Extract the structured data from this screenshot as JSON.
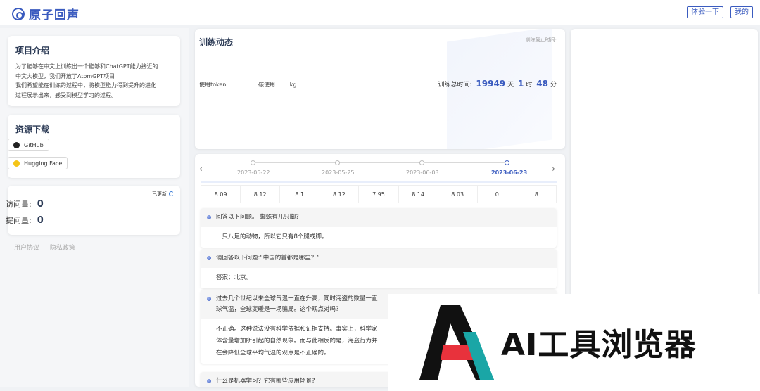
{
  "header": {
    "logo_text": "原子回声",
    "try_button": "体验一下",
    "mine_button": "我的"
  },
  "intro": {
    "title": "项目介绍",
    "lines": [
      "为了能够在中文上训练出一个能够和ChatGPT能力接近的",
      "中文大模型，我们开放了AtomGPT项目",
      "我们希望能在训练的过程中，将模型能力得到提升的进化",
      "过程展示出来，感受到模型学习的过程。"
    ]
  },
  "downloads": {
    "title": "资源下载",
    "github": "GitHub",
    "huggingface": "Hugging Face"
  },
  "stats": {
    "updated": "已更新",
    "visit_label": "访问量:",
    "visit_value": "0",
    "ask_label": "提问量:",
    "ask_value": "0"
  },
  "footer": {
    "agreement": "用户协议",
    "privacy": "隐私政策"
  },
  "training": {
    "title": "训练动态",
    "deadline": "训练截止时间:",
    "token_label": "使用token:",
    "carbon_label": "碳使用:",
    "carbon_unit": "kg",
    "total_label": "训练总时间:",
    "days": "19949",
    "days_unit": "天",
    "hours": "1",
    "hours_unit": "时",
    "minutes": "48",
    "minutes_unit": "分"
  },
  "timeline": {
    "dates": [
      "2023-05-22",
      "2023-05-25",
      "2023-06-03",
      "2023-06-23"
    ],
    "active_index": 3,
    "scores": [
      "8.09",
      "8.12",
      "8.1",
      "8.12",
      "7.95",
      "8.14",
      "8.03",
      "0",
      "8"
    ]
  },
  "qa": [
    {
      "q": "回答以下问题。 蜘蛛有几只脚?",
      "a": "一只八足的动物，所以它只有8个腿或脚。"
    },
    {
      "q": "请回答以下问题:“中国的首都是哪里？”",
      "a": "答案：北京。"
    },
    {
      "q": "过去几个世纪以来全球气温一直在升高，同时海盗的数量一直",
      "q2": "球气温，全球变暖是一场骗局。这个观点对吗?",
      "a": "不正确。这种说法没有科学依据和证据支持。事实上，科学家",
      "a2": "体含量增加所引起的自然现象。而与此相反的是，海盗行为并",
      "a3": "在会降低全球平均气温的观点是不正确的。"
    },
    {
      "q": "什么是机器学习？它有哪些应用场景?"
    }
  ],
  "watermark": {
    "text": "AI工具浏览器"
  },
  "colors": {
    "accent": "#3a5bbf",
    "watermark_red": "#e8323c",
    "watermark_teal": "#1aa6a6"
  }
}
